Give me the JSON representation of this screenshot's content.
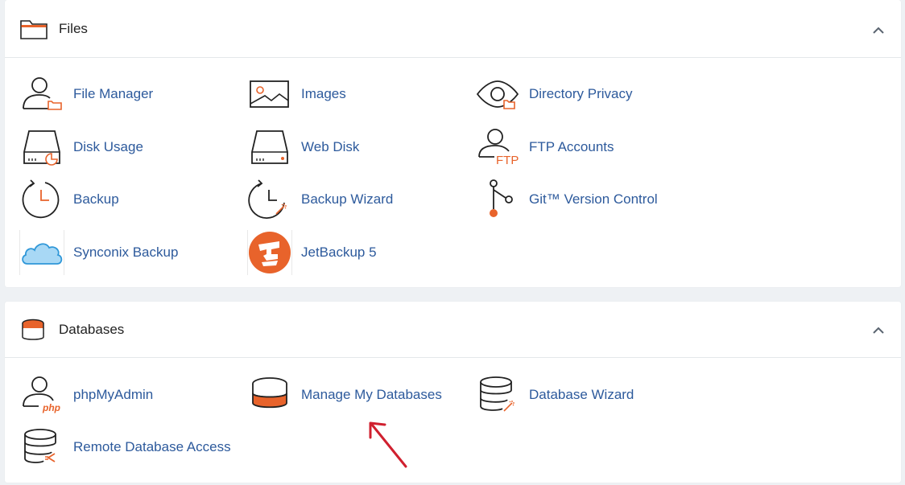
{
  "files": {
    "title": "Files",
    "items": [
      {
        "label": "File Manager",
        "icon": "file-manager-icon"
      },
      {
        "label": "Images",
        "icon": "images-icon"
      },
      {
        "label": "Directory Privacy",
        "icon": "directory-privacy-icon"
      },
      {
        "label": "Disk Usage",
        "icon": "disk-usage-icon"
      },
      {
        "label": "Web Disk",
        "icon": "web-disk-icon"
      },
      {
        "label": "FTP Accounts",
        "icon": "ftp-accounts-icon"
      },
      {
        "label": "Backup",
        "icon": "backup-icon"
      },
      {
        "label": "Backup Wizard",
        "icon": "backup-wizard-icon"
      },
      {
        "label": "Git™ Version Control",
        "icon": "git-version-control-icon"
      },
      {
        "label": "Synconix Backup",
        "icon": "cloud-icon"
      },
      {
        "label": "JetBackup 5",
        "icon": "jetbackup-icon"
      }
    ],
    "ftp_badge": "FTP"
  },
  "databases": {
    "title": "Databases",
    "items": [
      {
        "label": "phpMyAdmin",
        "icon": "phpmyadmin-icon"
      },
      {
        "label": "Manage My Databases",
        "icon": "manage-databases-icon"
      },
      {
        "label": "Database Wizard",
        "icon": "database-wizard-icon"
      },
      {
        "label": "Remote Database Access",
        "icon": "remote-database-icon"
      }
    ],
    "php_badge": "php"
  },
  "colors": {
    "link": "#2d5a9c",
    "accent": "#e8632b",
    "arrow": "#d0202f"
  }
}
